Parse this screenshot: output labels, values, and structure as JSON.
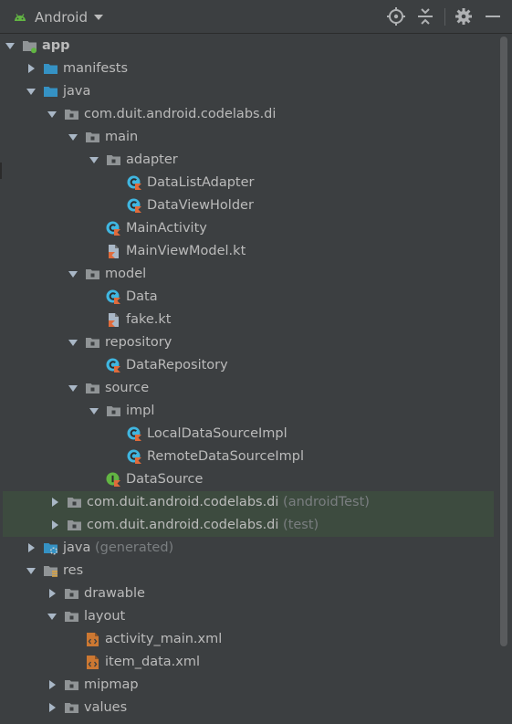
{
  "toolbar": {
    "view_label": "Android",
    "icons": [
      "locate-icon",
      "collapse-all-icon",
      "gear-icon",
      "minimize-icon"
    ]
  },
  "tree": [
    {
      "label": "app",
      "bold": true,
      "icon": "module-folder-icon",
      "arrow": "down"
    },
    {
      "label": "manifests",
      "icon": "folder-icon",
      "arrow": "right"
    },
    {
      "label": "java",
      "icon": "folder-icon",
      "arrow": "down"
    },
    {
      "label": "com.duit.android.codelabs.di",
      "icon": "package-icon",
      "arrow": "down"
    },
    {
      "label": "main",
      "icon": "package-icon",
      "arrow": "down"
    },
    {
      "label": "adapter",
      "icon": "package-icon",
      "arrow": "down"
    },
    {
      "label": "DataListAdapter",
      "icon": "kotlin-class-icon"
    },
    {
      "label": "DataViewHolder",
      "icon": "kotlin-class-icon"
    },
    {
      "label": "MainActivity",
      "icon": "kotlin-class-icon"
    },
    {
      "label": "MainViewModel.kt",
      "icon": "kotlin-file-icon"
    },
    {
      "label": "model",
      "icon": "package-icon",
      "arrow": "down"
    },
    {
      "label": "Data",
      "icon": "kotlin-class-icon"
    },
    {
      "label": "fake.kt",
      "icon": "kotlin-file-icon"
    },
    {
      "label": "repository",
      "icon": "package-icon",
      "arrow": "down"
    },
    {
      "label": "DataRepository",
      "icon": "kotlin-class-icon"
    },
    {
      "label": "source",
      "icon": "package-icon",
      "arrow": "down"
    },
    {
      "label": "impl",
      "icon": "package-icon",
      "arrow": "down"
    },
    {
      "label": "LocalDataSourceImpl",
      "icon": "kotlin-class-icon"
    },
    {
      "label": "RemoteDataSourceImpl",
      "icon": "kotlin-class-icon"
    },
    {
      "label": "DataSource",
      "icon": "kotlin-interface-icon"
    },
    {
      "label": "com.duit.android.codelabs.di",
      "suffix": "(androidTest)",
      "icon": "package-icon",
      "arrow": "right",
      "highlight": true
    },
    {
      "label": "com.duit.android.codelabs.di",
      "suffix": "(test)",
      "icon": "package-icon",
      "arrow": "right",
      "highlight": true
    },
    {
      "label": "java",
      "suffix": "(generated)",
      "icon": "generated-folder-icon",
      "arrow": "right"
    },
    {
      "label": "res",
      "icon": "res-folder-icon",
      "arrow": "down"
    },
    {
      "label": "drawable",
      "icon": "package-icon",
      "arrow": "right"
    },
    {
      "label": "layout",
      "icon": "package-icon",
      "arrow": "down"
    },
    {
      "label": "activity_main.xml",
      "icon": "xml-file-icon"
    },
    {
      "label": "item_data.xml",
      "icon": "xml-file-icon"
    },
    {
      "label": "mipmap",
      "icon": "package-icon",
      "arrow": "right"
    },
    {
      "label": "values",
      "icon": "package-icon",
      "arrow": "right"
    }
  ],
  "colors": {
    "background": "#3c3f41",
    "text": "#bbbbbb",
    "muted_text": "#7a7e80",
    "highlight": "#3d4b3f",
    "folder_blue": "#3592c4",
    "kotlin_class": "#40b6e0",
    "kotlin_interface": "#62b543",
    "xml_orange": "#cc7832"
  }
}
